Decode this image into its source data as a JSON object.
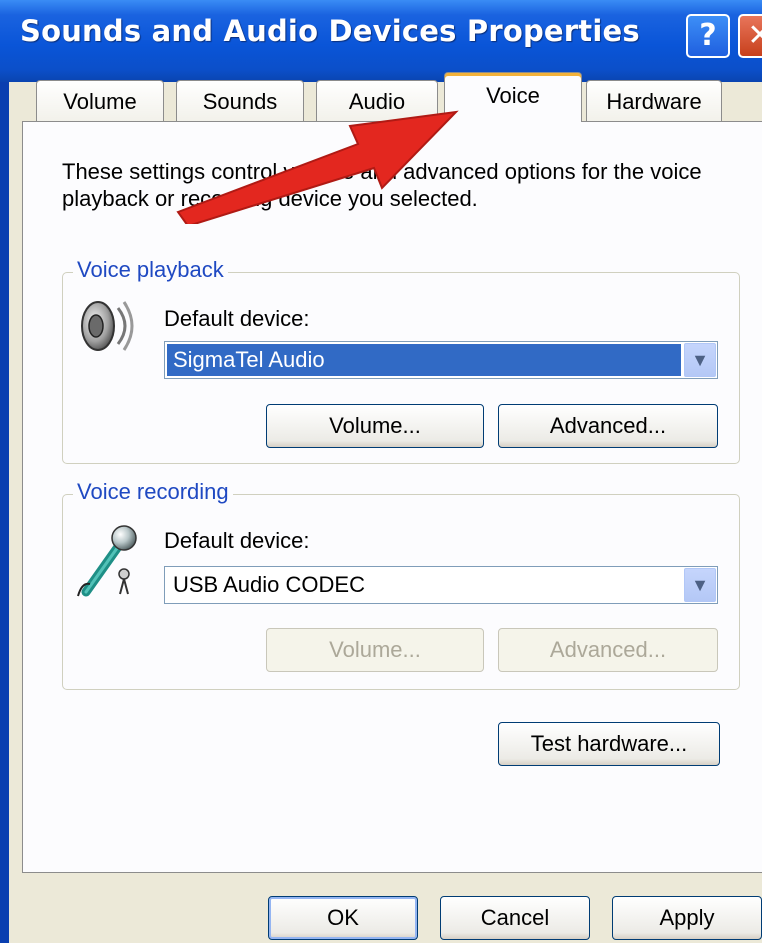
{
  "window": {
    "title": "Sounds and Audio Devices Properties",
    "help_glyph": "?",
    "close_glyph": "✕"
  },
  "tabs": [
    {
      "label": "Volume",
      "active": false
    },
    {
      "label": "Sounds",
      "active": false
    },
    {
      "label": "Audio",
      "active": false
    },
    {
      "label": "Voice",
      "active": true
    },
    {
      "label": "Hardware",
      "active": false
    }
  ],
  "description": "These settings control volume and advanced options for the voice playback or recording device you selected.",
  "playback": {
    "legend": "Voice playback",
    "icon": "speaker-icon",
    "default_device_label": "Default device:",
    "device_value": "SigmaTel Audio",
    "volume_button": "Volume...",
    "advanced_button": "Advanced..."
  },
  "recording": {
    "legend": "Voice recording",
    "icon": "microphone-icon",
    "default_device_label": "Default device:",
    "device_value": "USB Audio CODEC",
    "volume_button": "Volume...",
    "advanced_button": "Advanced..."
  },
  "test_hardware_button": "Test hardware...",
  "footer": {
    "ok": "OK",
    "cancel": "Cancel",
    "apply": "Apply"
  },
  "colors": {
    "titlebar": "#0a55d8",
    "group_legend": "#1f49c2",
    "selection": "#316ac5",
    "annotation_arrow": "#e3271f"
  },
  "annotation": {
    "icon": "red-arrow-icon",
    "points_to": "Voice"
  }
}
